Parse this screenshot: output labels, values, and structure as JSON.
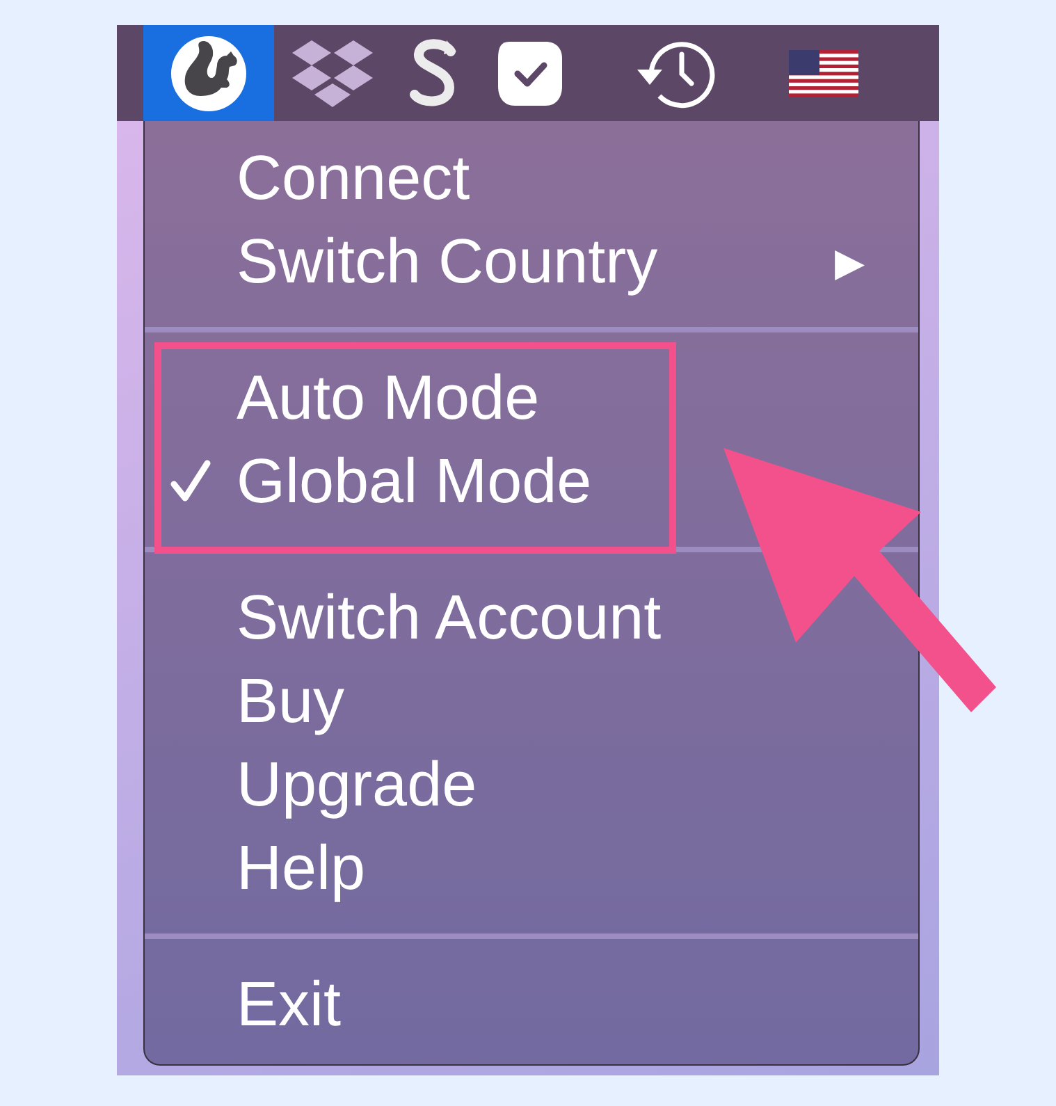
{
  "menu_bar": {
    "items": [
      {
        "kind": "squirrel",
        "selected": true
      },
      {
        "kind": "diamonds",
        "selected": false
      },
      {
        "kind": "scurve",
        "selected": false
      },
      {
        "kind": "checkbubble",
        "selected": false
      },
      {
        "kind": "history",
        "selected": false
      },
      {
        "kind": "flag",
        "selected": false
      }
    ]
  },
  "menu": {
    "entries": [
      {
        "kind": "item",
        "label": "Connect",
        "checked": false
      },
      {
        "kind": "item",
        "label": "Switch Country",
        "checked": false,
        "submenu_arrow": "▶"
      },
      {
        "kind": "separator"
      },
      {
        "kind": "item",
        "label": "Auto Mode",
        "checked": false
      },
      {
        "kind": "item",
        "label": "Global Mode",
        "checked": true
      },
      {
        "kind": "separator"
      },
      {
        "kind": "item",
        "label": "Switch Account",
        "checked": false
      },
      {
        "kind": "item",
        "label": "Buy",
        "checked": false
      },
      {
        "kind": "item",
        "label": "Upgrade",
        "checked": false
      },
      {
        "kind": "item",
        "label": "Help",
        "checked": false
      },
      {
        "kind": "separator"
      },
      {
        "kind": "item",
        "label": "Exit",
        "checked": false
      }
    ]
  }
}
